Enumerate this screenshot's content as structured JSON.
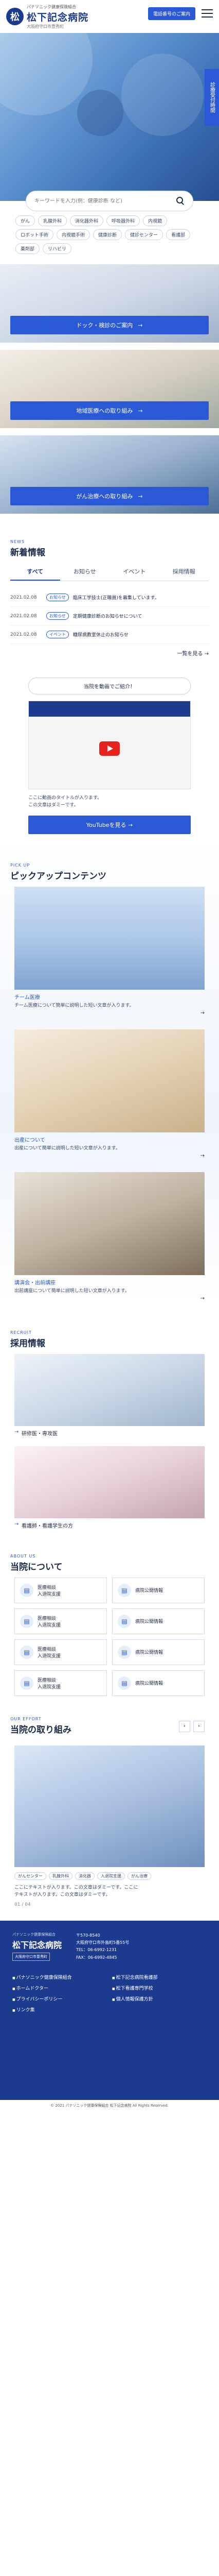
{
  "header": {
    "logo_char": "松",
    "logo_sub": "パナソニック健康保険組合",
    "logo_main": "松下記念病院",
    "logo_tag": "大阪府守口市豊秀町",
    "cta": "電話番号のご案内",
    "side_label": "診療受付時間"
  },
  "search": {
    "placeholder": "キーワードを入力(例：健康診断 など)",
    "tags": [
      "がん",
      "乳腺外科",
      "消化器外科",
      "呼吸器外科",
      "内視鏡",
      "ロボット手術",
      "内視鏡手術",
      "健康診断",
      "健診センター",
      "看護部",
      "薬剤部",
      "リハビリ"
    ]
  },
  "banners": [
    {
      "label": "ドック・検診のご案内"
    },
    {
      "label": "地域医療への取り組み"
    },
    {
      "label": "がん治療への取り組み"
    }
  ],
  "news": {
    "kicker": "NEWS",
    "title": "新着情報",
    "tabs": [
      "すべて",
      "お知らせ",
      "イベント",
      "採用情報"
    ],
    "items": [
      {
        "date": "2021.02.08",
        "cat": "お知らせ",
        "text": "臨床工学技士(正職員)を募集しています。"
      },
      {
        "date": "2021.02.08",
        "cat": "お知らせ",
        "text": "定期健康診断のお知らせについて"
      },
      {
        "date": "2021.02.08",
        "cat": "イベント",
        "text": "糖尿病教室休止のお知らせ"
      }
    ],
    "more": "一覧を見る →"
  },
  "video": {
    "heading": "当院を動画でご紹介！",
    "desc1": "ここに動画のタイトルが入ります。",
    "desc2": "この文章はダミーです。",
    "button": "YouTubeを見る →"
  },
  "pickup": {
    "kicker": "PICK UP",
    "title": "ピックアップコンテンツ",
    "cards": [
      {
        "name": "チーム医療",
        "desc": "チーム医療について簡単に説明した短い文章が入ります。"
      },
      {
        "name": "出産について",
        "desc": "出産について簡単に説明した短い文章が入ります。"
      },
      {
        "name": "講演会・出前講座",
        "desc": "出前講座について簡単に説明した短い文章が入ります。"
      }
    ]
  },
  "recruit": {
    "kicker": "RECRUIT",
    "title": "採用情報",
    "cards": [
      {
        "label": "研修医・専攻医"
      },
      {
        "label": "看護師・看護学生の方"
      }
    ]
  },
  "about": {
    "kicker": "ABOUT US",
    "title": "当院について",
    "cells": [
      "医療相談\n入退院支援",
      "病院公開情報",
      "医療相談\n入退院支援",
      "病院公開情報",
      "医療相談\n入退院支援",
      "病院公開情報",
      "医療相談\n入退院支援",
      "病院公開情報"
    ]
  },
  "efforts": {
    "kicker": "OUR EFFORT",
    "title": "当院の取り組み",
    "tags": [
      "がんセンター",
      "乳腺外科",
      "消化器",
      "入退院支援",
      "がん治療"
    ],
    "desc1": "ここにテキストが入ります。この文章はダミーです。ここに",
    "desc2": "テキストが入ります。この文章はダミーです。",
    "counter": "01 / 04"
  },
  "footer": {
    "logo_sub": "パナソニック健康保険組合",
    "logo_main": "松下記念病院",
    "logo_tag": "大阪府守口市豊秀町",
    "postal": "〒570-8540",
    "address": "大阪府守口市外島町5番55号",
    "tel": "TEL：06-6992-1231",
    "fax": "FAX：06-6992-4845",
    "links": [
      "パナソニック健康保険組合",
      "松下記念病院看護部",
      "ホームドクター",
      "松下看護専門学校",
      "プライバシーポリシー",
      "個人情報保護方針",
      "リンク集"
    ],
    "copy": "© 2021 パナソニック健康保険組合 松下記念病院 All Rights Reserved."
  },
  "colors": {
    "brand": "#1c3b8f",
    "accent": "#2b59d6"
  }
}
